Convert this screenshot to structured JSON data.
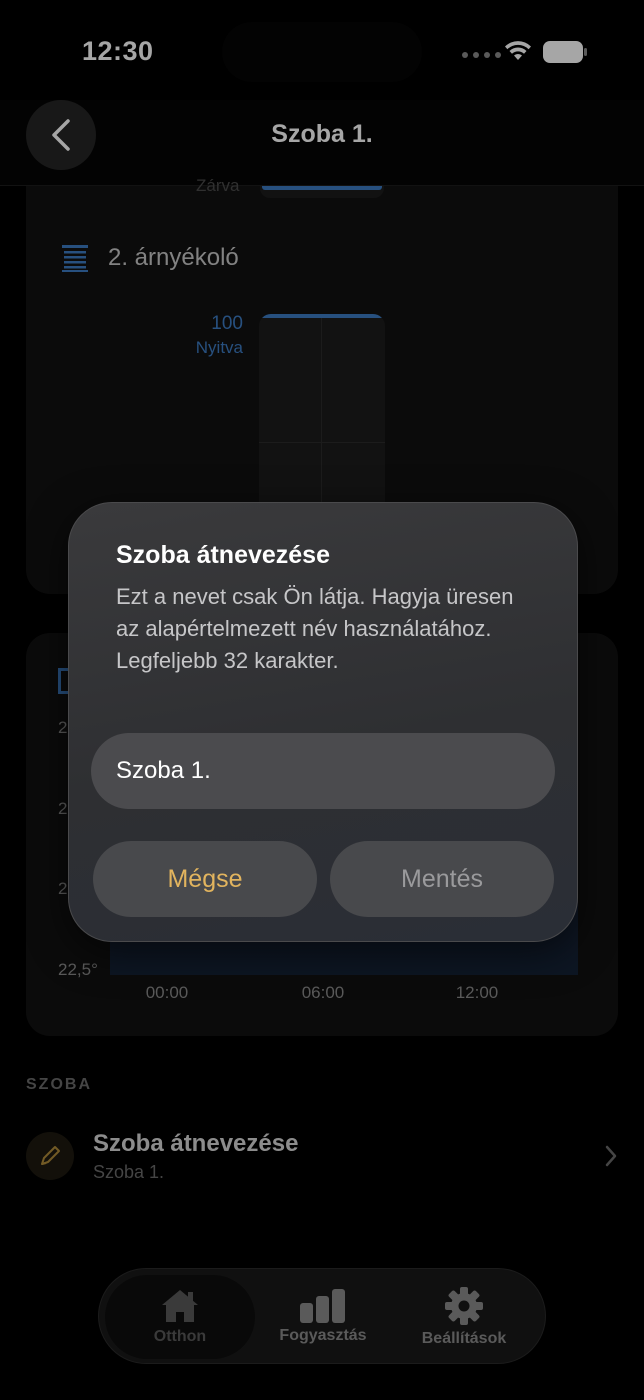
{
  "status_bar": {
    "time": "12:30"
  },
  "header": {
    "title": "Szoba 1."
  },
  "shade_card": {
    "prev_state": "Zárva",
    "title": "2. árnyékoló",
    "value": "100",
    "state": "Nyitva",
    "level_percent": 100
  },
  "temperature_card": {
    "y_labels": [
      "2",
      "2",
      "2",
      "22,5°"
    ],
    "x_labels": [
      "00:00",
      "06:00",
      "12:00"
    ]
  },
  "section": {
    "label": "SZOBA",
    "rename_title": "Szoba átnevezése",
    "rename_sub": "Szoba 1."
  },
  "dialog": {
    "title": "Szoba átnevezése",
    "message": "Ezt a nevet csak Ön látja. Hagyja üresen az alapértelmezett név használatához. Legfeljebb 32 karakter.",
    "input_value": "Szoba 1.",
    "cancel": "Mégse",
    "save": "Mentés"
  },
  "tabs": [
    {
      "label": "Otthon",
      "icon": "home-icon",
      "active": true
    },
    {
      "label": "Fogyasztás",
      "icon": "bar-chart-icon",
      "active": false
    },
    {
      "label": "Beállítások",
      "icon": "gear-icon",
      "active": false
    }
  ],
  "colors": {
    "accent_blue": "#3d7cc4",
    "cancel_gold": "#e2b45e",
    "background": "#000000"
  }
}
